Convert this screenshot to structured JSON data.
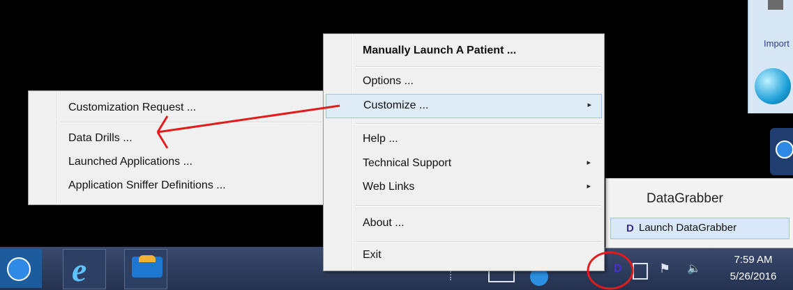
{
  "desktop": {
    "window_label": "Import",
    "colors": {
      "background": "#000000",
      "annotation": "#e21b1b"
    }
  },
  "context_menu": {
    "items": [
      {
        "label": "Manually Launch A Patient ...",
        "bold": true
      },
      {
        "label": "Options ..."
      },
      {
        "label": "Customize ...",
        "submenu": true,
        "highlighted": true
      },
      {
        "label": "Help ..."
      },
      {
        "label": "Technical Support",
        "submenu": true
      },
      {
        "label": "Web Links",
        "submenu": true
      },
      {
        "label": "About ..."
      },
      {
        "label": "Exit"
      }
    ],
    "submenu_arrow": "▸"
  },
  "customize_submenu": {
    "items": [
      {
        "label": "Customization Request ..."
      },
      {
        "label": "Data Drills ..."
      },
      {
        "label": "Launched Applications ..."
      },
      {
        "label": "Application Sniffer Definitions ..."
      }
    ]
  },
  "tray_popup": {
    "title": "DataGrabber",
    "launch_label": "Launch DataGrabber",
    "launch_icon_glyph": "D"
  },
  "taskbar": {
    "apps": [
      {
        "name": "teamviewer-icon"
      },
      {
        "name": "internet-explorer-icon",
        "glyph": "e"
      },
      {
        "name": "app-icon"
      }
    ],
    "tray_glyphs": {
      "datagrabber": "D",
      "flag": "⚑",
      "volume": "🔈"
    },
    "clock": {
      "time": "7:59 AM",
      "date": "5/26/2016"
    }
  }
}
